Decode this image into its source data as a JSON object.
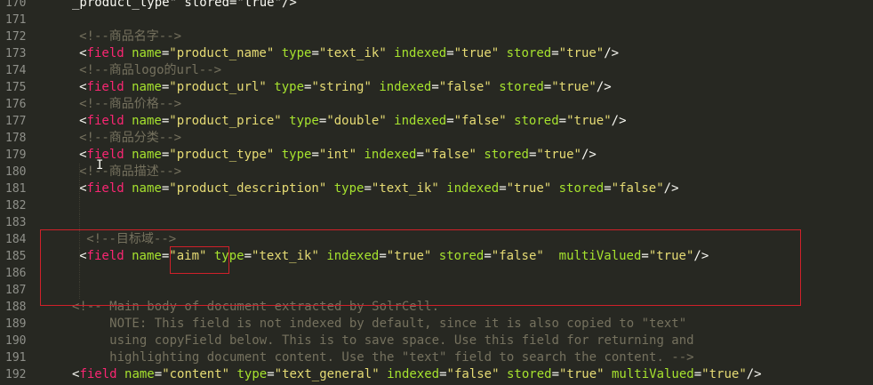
{
  "editor": {
    "lines": [
      {
        "num": "170",
        "col": 10,
        "tokens": [
          {
            "t": "_product_type\" stored=\"true\"/>",
            "c": "text"
          }
        ]
      },
      {
        "num": "171",
        "col": 10,
        "tokens": []
      },
      {
        "num": "172",
        "col": 11,
        "tokens": [
          {
            "t": "<!--商品名字-->",
            "c": "comment"
          }
        ]
      },
      {
        "num": "173",
        "col": 11,
        "tokens": [
          {
            "t": "<",
            "c": "punc"
          },
          {
            "t": "field",
            "c": "tag"
          },
          {
            "t": " name",
            "c": "attr"
          },
          {
            "t": "=",
            "c": "punc"
          },
          {
            "t": "\"product_name\"",
            "c": "str"
          },
          {
            "t": " type",
            "c": "attr"
          },
          {
            "t": "=",
            "c": "punc"
          },
          {
            "t": "\"text_ik\"",
            "c": "str"
          },
          {
            "t": " indexed",
            "c": "attr"
          },
          {
            "t": "=",
            "c": "punc"
          },
          {
            "t": "\"true\"",
            "c": "str"
          },
          {
            "t": " stored",
            "c": "attr"
          },
          {
            "t": "=",
            "c": "punc"
          },
          {
            "t": "\"true\"",
            "c": "str"
          },
          {
            "t": "/>",
            "c": "punc"
          }
        ]
      },
      {
        "num": "174",
        "col": 11,
        "tokens": [
          {
            "t": "<!--商品logo的url-->",
            "c": "comment"
          }
        ]
      },
      {
        "num": "175",
        "col": 11,
        "tokens": [
          {
            "t": "<",
            "c": "punc"
          },
          {
            "t": "field",
            "c": "tag"
          },
          {
            "t": " name",
            "c": "attr"
          },
          {
            "t": "=",
            "c": "punc"
          },
          {
            "t": "\"product_url\"",
            "c": "str"
          },
          {
            "t": " type",
            "c": "attr"
          },
          {
            "t": "=",
            "c": "punc"
          },
          {
            "t": "\"string\"",
            "c": "str"
          },
          {
            "t": " indexed",
            "c": "attr"
          },
          {
            "t": "=",
            "c": "punc"
          },
          {
            "t": "\"false\"",
            "c": "str"
          },
          {
            "t": " stored",
            "c": "attr"
          },
          {
            "t": "=",
            "c": "punc"
          },
          {
            "t": "\"true\"",
            "c": "str"
          },
          {
            "t": "/>",
            "c": "punc"
          }
        ]
      },
      {
        "num": "176",
        "col": 11,
        "tokens": [
          {
            "t": "<!--商品价格-->",
            "c": "comment"
          }
        ]
      },
      {
        "num": "177",
        "col": 11,
        "tokens": [
          {
            "t": "<",
            "c": "punc"
          },
          {
            "t": "field",
            "c": "tag"
          },
          {
            "t": " name",
            "c": "attr"
          },
          {
            "t": "=",
            "c": "punc"
          },
          {
            "t": "\"product_price\"",
            "c": "str"
          },
          {
            "t": " type",
            "c": "attr"
          },
          {
            "t": "=",
            "c": "punc"
          },
          {
            "t": "\"double\"",
            "c": "str"
          },
          {
            "t": " indexed",
            "c": "attr"
          },
          {
            "t": "=",
            "c": "punc"
          },
          {
            "t": "\"false\"",
            "c": "str"
          },
          {
            "t": " stored",
            "c": "attr"
          },
          {
            "t": "=",
            "c": "punc"
          },
          {
            "t": "\"true\"",
            "c": "str"
          },
          {
            "t": "/>",
            "c": "punc"
          }
        ]
      },
      {
        "num": "178",
        "col": 11,
        "tokens": [
          {
            "t": "<!--商品分类-->",
            "c": "comment"
          }
        ]
      },
      {
        "num": "179",
        "col": 11,
        "tokens": [
          {
            "t": "<",
            "c": "punc"
          },
          {
            "t": "field",
            "c": "tag"
          },
          {
            "t": " name",
            "c": "attr"
          },
          {
            "t": "=",
            "c": "punc"
          },
          {
            "t": "\"product_type\"",
            "c": "str"
          },
          {
            "t": " type",
            "c": "attr"
          },
          {
            "t": "=",
            "c": "punc"
          },
          {
            "t": "\"int\"",
            "c": "str"
          },
          {
            "t": " indexed",
            "c": "attr"
          },
          {
            "t": "=",
            "c": "punc"
          },
          {
            "t": "\"false\"",
            "c": "str"
          },
          {
            "t": " stored",
            "c": "attr"
          },
          {
            "t": "=",
            "c": "punc"
          },
          {
            "t": "\"true\"",
            "c": "str"
          },
          {
            "t": "/>",
            "c": "punc"
          }
        ]
      },
      {
        "num": "180",
        "col": 11,
        "tokens": [
          {
            "t": "<!--商品描述-->",
            "c": "comment"
          }
        ]
      },
      {
        "num": "181",
        "col": 11,
        "tokens": [
          {
            "t": "<",
            "c": "punc"
          },
          {
            "t": "field",
            "c": "tag"
          },
          {
            "t": " name",
            "c": "attr"
          },
          {
            "t": "=",
            "c": "punc"
          },
          {
            "t": "\"product_description\"",
            "c": "str"
          },
          {
            "t": " type",
            "c": "attr"
          },
          {
            "t": "=",
            "c": "punc"
          },
          {
            "t": "\"text_ik\"",
            "c": "str"
          },
          {
            "t": " indexed",
            "c": "attr"
          },
          {
            "t": "=",
            "c": "punc"
          },
          {
            "t": "\"true\"",
            "c": "str"
          },
          {
            "t": " stored",
            "c": "attr"
          },
          {
            "t": "=",
            "c": "punc"
          },
          {
            "t": "\"false\"",
            "c": "str"
          },
          {
            "t": "/>",
            "c": "punc"
          }
        ]
      },
      {
        "num": "182",
        "col": 11,
        "tokens": []
      },
      {
        "num": "183",
        "col": 11,
        "tokens": []
      },
      {
        "num": "184",
        "col": 12,
        "tokens": [
          {
            "t": "<!--目标域-->",
            "c": "comment"
          }
        ]
      },
      {
        "num": "185",
        "col": 11,
        "tokens": [
          {
            "t": "<",
            "c": "punc"
          },
          {
            "t": "field",
            "c": "tag"
          },
          {
            "t": " name",
            "c": "attr"
          },
          {
            "t": "=",
            "c": "punc"
          },
          {
            "t": "\"aim\"",
            "c": "str"
          },
          {
            "t": " type",
            "c": "attr"
          },
          {
            "t": "=",
            "c": "punc"
          },
          {
            "t": "\"text_ik\"",
            "c": "str"
          },
          {
            "t": " indexed",
            "c": "attr"
          },
          {
            "t": "=",
            "c": "punc"
          },
          {
            "t": "\"true\"",
            "c": "str"
          },
          {
            "t": " stored",
            "c": "attr"
          },
          {
            "t": "=",
            "c": "punc"
          },
          {
            "t": "\"false\"",
            "c": "str"
          },
          {
            "t": "  multiValued",
            "c": "attr"
          },
          {
            "t": "=",
            "c": "punc"
          },
          {
            "t": "\"true\"",
            "c": "str"
          },
          {
            "t": "/>",
            "c": "punc"
          }
        ]
      },
      {
        "num": "186",
        "col": 11,
        "tokens": []
      },
      {
        "num": "187",
        "col": 11,
        "tokens": []
      },
      {
        "num": "188",
        "col": 10,
        "tokens": [
          {
            "t": "<!-- Main body of document extracted by SolrCell.",
            "c": "comment"
          }
        ]
      },
      {
        "num": "189",
        "col": 10,
        "tokens": [
          {
            "t": "     NOTE: This field is not indexed by default, since it is also copied to \"text\"",
            "c": "comment"
          }
        ]
      },
      {
        "num": "190",
        "col": 10,
        "tokens": [
          {
            "t": "     using copyField below. This is to save space. Use this field for returning and",
            "c": "comment"
          }
        ]
      },
      {
        "num": "191",
        "col": 10,
        "tokens": [
          {
            "t": "     highlighting document content. Use the \"text\" field to search the content. -->",
            "c": "comment"
          }
        ]
      },
      {
        "num": "192",
        "col": 10,
        "tokens": [
          {
            "t": "<",
            "c": "punc"
          },
          {
            "t": "field",
            "c": "tag"
          },
          {
            "t": " name",
            "c": "attr"
          },
          {
            "t": "=",
            "c": "punc"
          },
          {
            "t": "\"content\"",
            "c": "str"
          },
          {
            "t": " type",
            "c": "attr"
          },
          {
            "t": "=",
            "c": "punc"
          },
          {
            "t": "\"text_general\"",
            "c": "str"
          },
          {
            "t": " indexed",
            "c": "attr"
          },
          {
            "t": "=",
            "c": "punc"
          },
          {
            "t": "\"false\"",
            "c": "str"
          },
          {
            "t": " stored",
            "c": "attr"
          },
          {
            "t": "=",
            "c": "punc"
          },
          {
            "t": "\"true\"",
            "c": "str"
          },
          {
            "t": " multiValued",
            "c": "attr"
          },
          {
            "t": "=",
            "c": "punc"
          },
          {
            "t": "\"true\"",
            "c": "str"
          },
          {
            "t": "/>",
            "c": "punc"
          }
        ]
      }
    ]
  },
  "colors": {
    "background": "#272822",
    "comment": "#75715e",
    "tag": "#f92672",
    "attribute": "#a6e22e",
    "string": "#e6db74",
    "annotation": "#d0202a"
  },
  "icons": {
    "text_cursor": "i-beam-cursor-icon"
  }
}
